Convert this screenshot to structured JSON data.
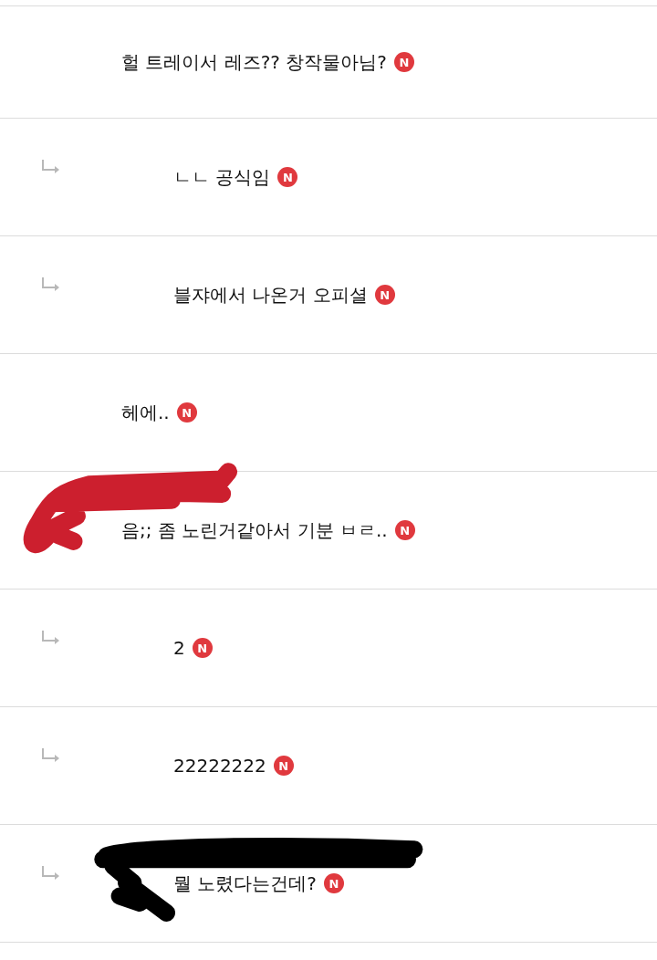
{
  "comments": [
    {
      "kind": "comment",
      "text": "헐 트레이서 레즈?? 창작물아님?",
      "badge": "N"
    },
    {
      "kind": "reply",
      "text": "ㄴㄴ 공식임",
      "badge": "N"
    },
    {
      "kind": "reply",
      "text": "블쟈에서 나온거 오피셜",
      "badge": "N"
    },
    {
      "kind": "comment",
      "text": "헤에..",
      "badge": "N"
    },
    {
      "kind": "comment",
      "text": "음;; 좀 노린거같아서 기분 ㅂㄹ..",
      "badge": "N",
      "color": "#cc1f2e"
    },
    {
      "kind": "reply",
      "text": "2",
      "badge": "N"
    },
    {
      "kind": "reply",
      "text": "22222222",
      "badge": "N"
    },
    {
      "kind": "reply",
      "text": "뭘 노렸다는건데?",
      "badge": "N",
      "color": "#000000"
    }
  ]
}
